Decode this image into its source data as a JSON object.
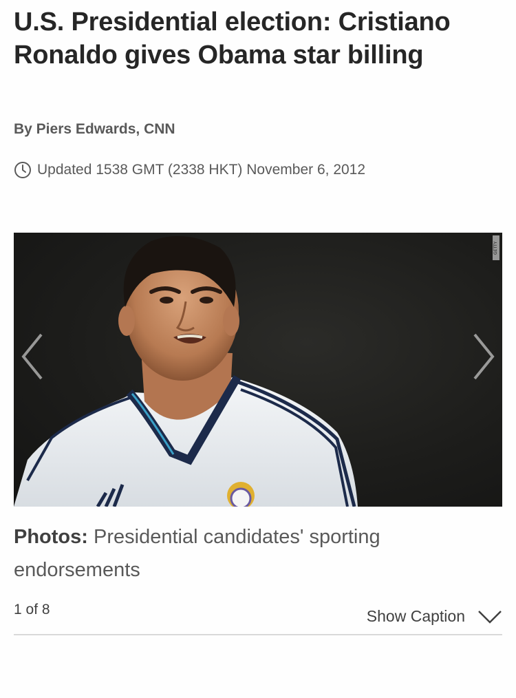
{
  "article": {
    "headline": "U.S. Presidential election: Cristiano Ronaldo gives Obama star billing",
    "byline": "By Piers Edwards, CNN",
    "updated": "Updated 1538 GMT (2338 HKT) November 6, 2012"
  },
  "gallery": {
    "image_alt": "Cristiano Ronaldo in a white Real Madrid shirt",
    "credit": "GETTY IMAGES",
    "prev_icon": "chevron-left-icon",
    "next_icon": "chevron-right-icon",
    "caption_lead": "Photos:",
    "caption_text": " Presidential candidates' sporting endorsements",
    "counter": "1 of 8",
    "show_caption_label": "Show Caption",
    "show_caption_icon": "chevron-down-icon"
  },
  "colors": {
    "headline": "#262626",
    "meta": "#595959",
    "divider": "#d9d9d9"
  }
}
